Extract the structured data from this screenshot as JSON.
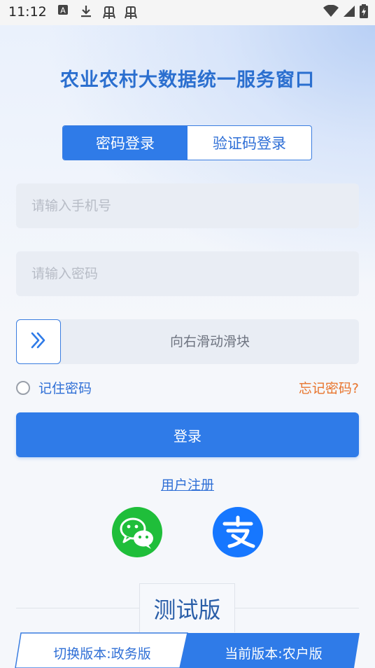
{
  "status_bar": {
    "time": "11:12",
    "icons": [
      "a-box-icon",
      "download-icon",
      "bug-icon",
      "bug-icon",
      "wifi-icon",
      "signal-icon",
      "battery-charging-icon"
    ]
  },
  "app": {
    "title": "农业农村大数据统一服务窗口"
  },
  "tabs": [
    {
      "label": "密码登录",
      "active": true
    },
    {
      "label": "验证码登录",
      "active": false
    }
  ],
  "form": {
    "phone_placeholder": "请输入手机号",
    "password_placeholder": "请输入密码",
    "slider_text": "向右滑动滑块",
    "remember_label": "记住密码",
    "forgot_label": "忘记密码?",
    "login_label": "登录",
    "register_label": "用户注册"
  },
  "social": [
    "wechat-icon",
    "alipay-icon"
  ],
  "footer": {
    "badge": "测试版",
    "switch_label": "切换版本:政务版",
    "current_label": "当前版本:农户版"
  },
  "colors": {
    "primary": "#2f7be8",
    "title": "#2b6fcf",
    "accent_orange": "#e8742c",
    "wechat": "#1fbe3a",
    "alipay": "#1677ff"
  }
}
